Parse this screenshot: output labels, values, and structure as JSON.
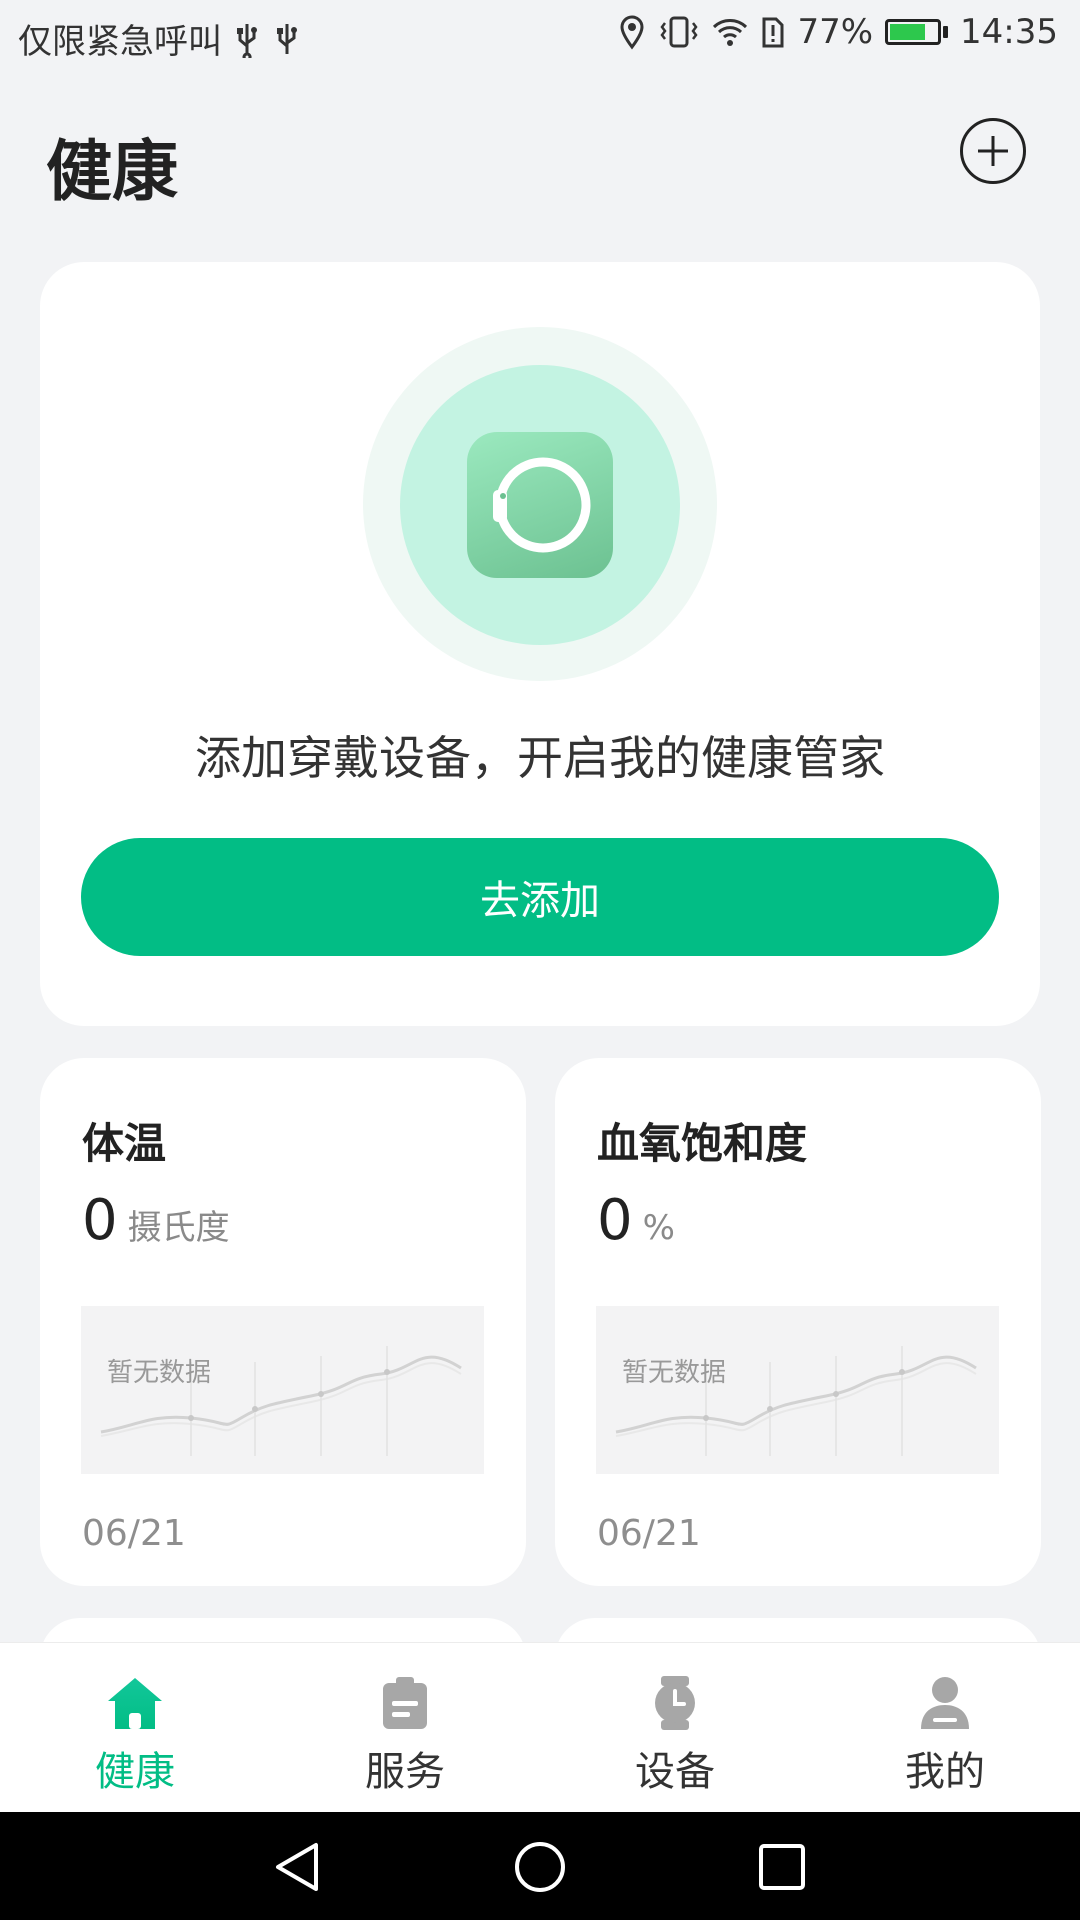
{
  "status_bar": {
    "carrier": "仅限紧急呼叫",
    "battery": "77%",
    "time": "14:35",
    "battery_level": 0.77
  },
  "header": {
    "title": "健康"
  },
  "device_card": {
    "prompt": "添加穿戴设备，开启我的健康管家",
    "button_label": "去添加"
  },
  "metrics": [
    {
      "title": "体温",
      "value": "0",
      "unit": "摄氏度",
      "empty_text": "暂无数据",
      "date": "06/21"
    },
    {
      "title": "血氧饱和度",
      "value": "0",
      "unit": "%",
      "empty_text": "暂无数据",
      "date": "06/21"
    }
  ],
  "nav": {
    "items": [
      {
        "label": "健康",
        "icon": "home-icon",
        "active": true
      },
      {
        "label": "服务",
        "icon": "clipboard-icon",
        "active": false
      },
      {
        "label": "设备",
        "icon": "watch-icon",
        "active": false
      },
      {
        "label": "我的",
        "icon": "person-icon",
        "active": false
      }
    ]
  },
  "colors": {
    "accent": "#02BD85",
    "background": "#F2F3F5",
    "inactive_icon": "#A7A7A7"
  }
}
